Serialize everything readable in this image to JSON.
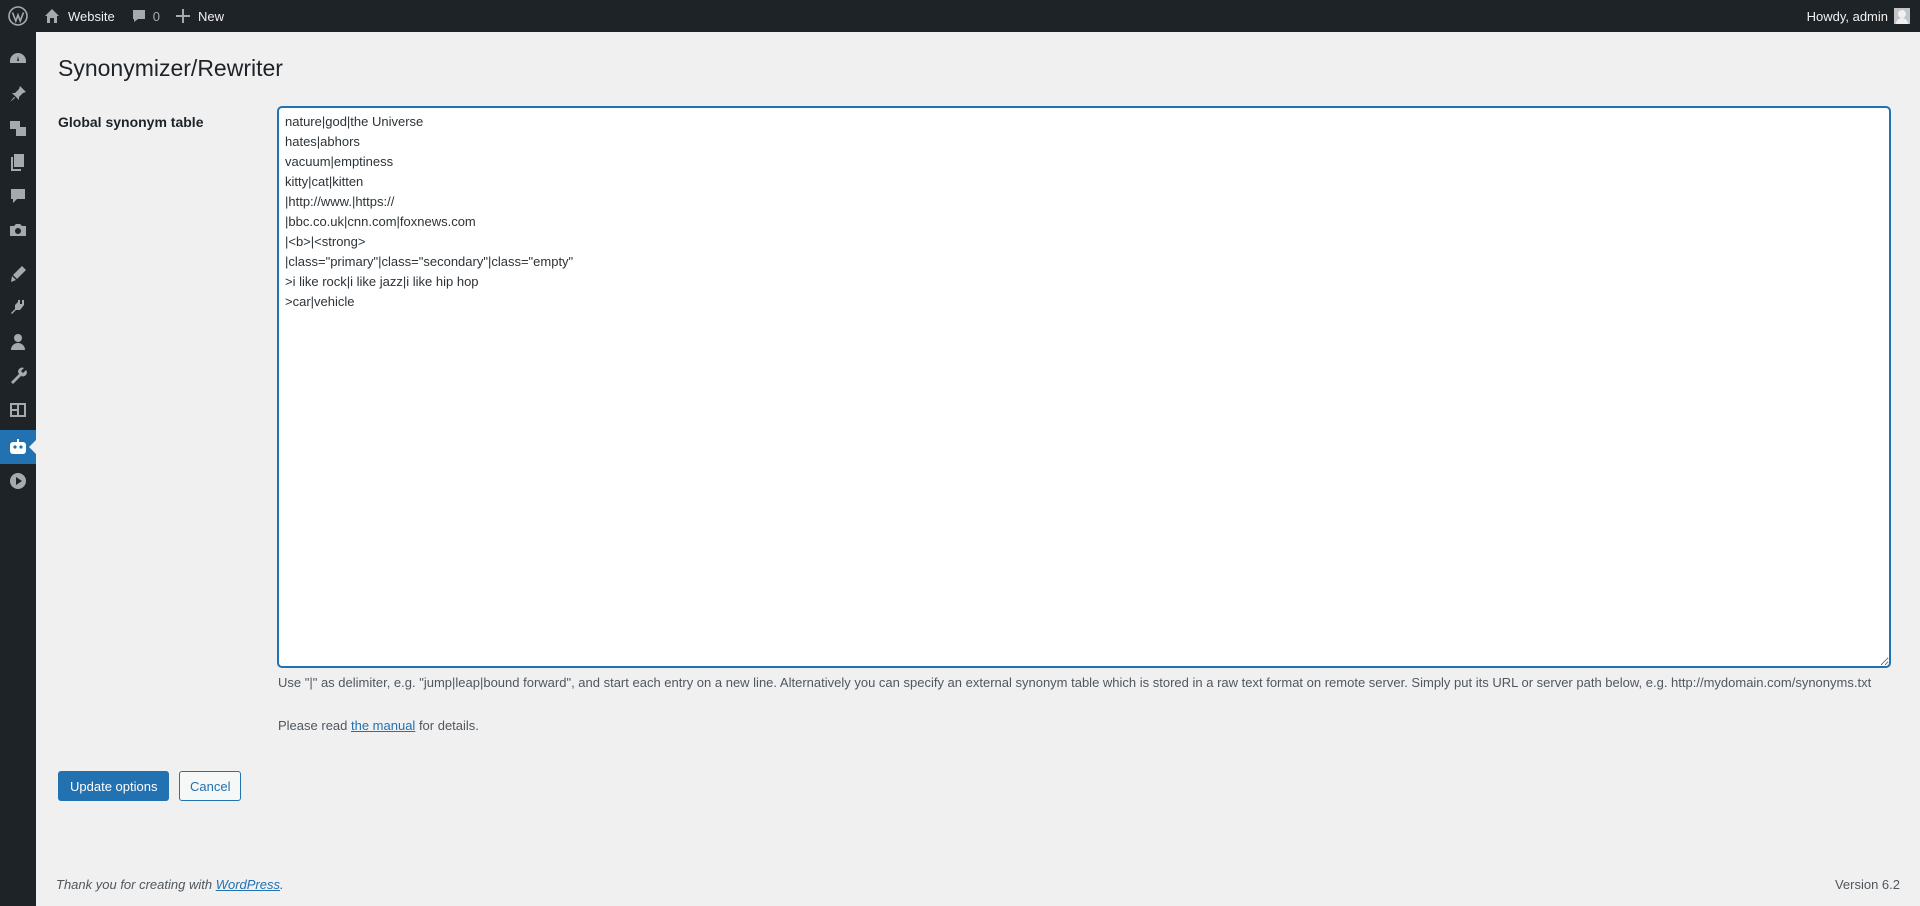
{
  "adminbar": {
    "site_name": "Website",
    "comments_count": "0",
    "new_label": "New",
    "howdy": "Howdy, admin"
  },
  "sidebar": {
    "icons": [
      "dashboard-icon",
      "pin-icon",
      "media-icon",
      "pages-icon",
      "comments-icon",
      "camera-icon",
      "appearance-icon",
      "plugins-icon",
      "users-icon",
      "tools-icon",
      "settings-icon",
      "robot-icon",
      "play-icon"
    ],
    "current": "robot-icon"
  },
  "page": {
    "title": "Synonymizer/Rewriter",
    "field_label": "Global synonym table",
    "textarea_value": "nature|god|the Universe\nhates|abhors\nvacuum|emptiness\nkitty|cat|kitten\n|http://www.|https://\n|bbc.co.uk|cnn.com|foxnews.com\n|<b>|<strong>\n|class=\"primary\"|class=\"secondary\"|class=\"empty\"\n>i like rock|i like jazz|i like hip hop\n>car|vehicle",
    "description": "Use \"|\" as delimiter, e.g. \"jump|leap|bound forward\", and start each entry on a new line. Alternatively you can specify an external synonym table which is stored in a raw text format on remote server. Simply put its URL or server path below, e.g. http://mydomain.com/synonyms.txt",
    "please_read_prefix": "Please read ",
    "manual_link": "the manual",
    "please_read_suffix": " for details.",
    "update_button": "Update options",
    "cancel_button": "Cancel"
  },
  "footer": {
    "thanks_prefix": "Thank you for creating with ",
    "wordpress_link": "WordPress",
    "thanks_suffix": ".",
    "version": "Version 6.2"
  },
  "colors": {
    "adminbar_bg": "#1d2327",
    "accent": "#2271b1",
    "page_bg": "#f0f0f1"
  }
}
